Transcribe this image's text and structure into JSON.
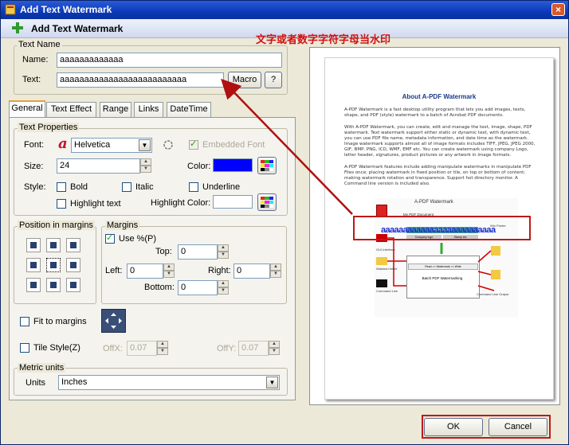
{
  "window": {
    "title": "Add Text Watermark",
    "close_glyph": "×"
  },
  "header": {
    "title": "Add Text Watermark"
  },
  "annotation": "文字或者数字字符字母当水印",
  "text_name": {
    "legend": "Text Name",
    "name_label": "Name:",
    "name_value": "aaaaaaaaaaaaa",
    "text_label": "Text:",
    "text_value": "aaaaaaaaaaaaaaaaaaaaaaaaaa",
    "macro_label": "Macro",
    "help_label": "?"
  },
  "tabs": [
    {
      "label": "General"
    },
    {
      "label": "Text Effect"
    },
    {
      "label": "Range"
    },
    {
      "label": "Links"
    },
    {
      "label": "DateTime"
    }
  ],
  "text_properties": {
    "legend": "Text Properties",
    "font_label": "Font:",
    "font_value": "Helvetica",
    "embedded_font_label": "Embedded Font",
    "size_label": "Size:",
    "size_value": "24",
    "color_label": "Color:",
    "color_value": "#0000ff",
    "style_label": "Style:",
    "bold_label": "Bold",
    "italic_label": "Italic",
    "underline_label": "Underline",
    "highlight_text_label": "Highlight text",
    "highlight_color_label": "Highlight Color:"
  },
  "position": {
    "legend": "Position in margins"
  },
  "margins": {
    "legend": "Margins",
    "use_percent_label": "Use %(P)",
    "top_label": "Top:",
    "top_value": "0",
    "left_label": "Left:",
    "left_value": "0",
    "right_label": "Right:",
    "right_value": "0",
    "bottom_label": "Bottom:",
    "bottom_value": "0"
  },
  "fit_to_margins_label": "Fit to margins",
  "tile": {
    "tile_style_label": "Tile Style(Z)",
    "offx_label": "OffX:",
    "offx_value": "0.07",
    "offy_label": "OffY:",
    "offy_value": "0.07"
  },
  "metric": {
    "legend": "Metric units",
    "units_label": "Units",
    "units_value": "Inches"
  },
  "buttons": {
    "ok_label": "OK",
    "cancel_label": "Cancel"
  },
  "preview": {
    "doc_title": "About A-PDF Watermark",
    "paragraphs": [
      "A-PDF Watermark is a fast desktop utility program that lets you add images, texts, shape, and PDF (style) watermark to a batch of Acrobat PDF documents.",
      "With A-PDF Watermark, you can create, edit and manage the text, image, shape, PDF watermark. Text watermark support either static or dynamic text, with dynamic text, you can use PDF file name, metadata information, and date time as the watermark. Image watermark supports almost all of image formats includes TIFF, JPEG, JPEG 2000, GIF, BMP, PNG, ICO, WMF, EMF etc. You can create watermark using company Logo, letter header, signatures, product pictures or any artwork in image formats.",
      "A-PDF Watermark features include adding manipulate watermarks in manipulate PDF Files once; placing watermark in fixed position or tile, on top or bottom of content; making watermark rotation and transparence. Support hot directory monitor. A Command line version is included also."
    ],
    "diagram_title": "A-PDF Watermark",
    "my_pdf_label": "My PDF Document",
    "watermark_text": "aaaaaaaaaaaaaaaaaaaaaaaaaa",
    "watermarks_label": "Watermarks",
    "company_logo_label": "Company logo",
    "stamp_label": "Stamp etc.",
    "win_printer_label": "Win Printer",
    "gui_label": "GUI Interface",
    "watched_folder_label": "Watched folder",
    "read_label": "Read >> Watermark >> Write",
    "batch_label": "Batch PDF Watermarking",
    "command_line_label": "Command Line",
    "command_line_output_label": "Command Line Output"
  }
}
